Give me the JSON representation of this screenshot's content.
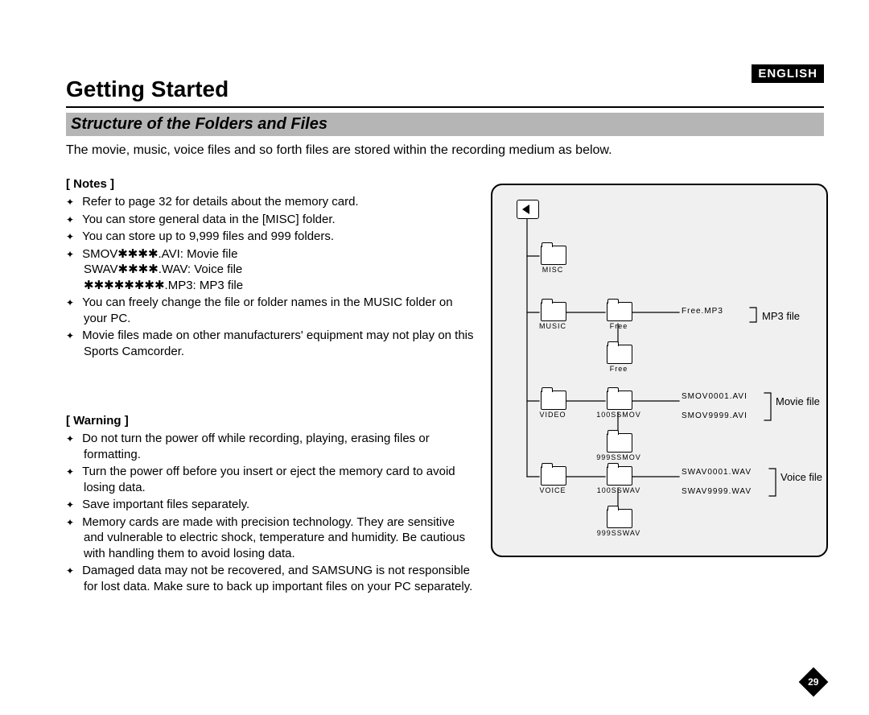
{
  "lang": "ENGLISH",
  "title": "Getting Started",
  "subtitle": "Structure of the Folders and Files",
  "intro": "The movie, music, voice files and so forth files are stored within the recording medium as below.",
  "notes": {
    "heading": "[ Notes ]",
    "items": [
      "Refer to page 32 for details about the memory card.",
      "You can store general data in the [MISC] folder.",
      "You can store up to 9,999 files and 999 folders.",
      "SMOV✱✱✱✱.AVI: Movie file\nSWAV✱✱✱✱.WAV: Voice file\n✱✱✱✱✱✱✱✱.MP3: MP3 file",
      "You can freely change the file or folder names in the MUSIC folder on your PC.",
      "Movie files made on other manufacturers' equipment may not play on this Sports Camcorder."
    ]
  },
  "warning": {
    "heading": "[ Warning ]",
    "items": [
      "Do not turn the power off while recording, playing, erasing files or formatting.",
      "Turn the power off before you insert or eject the memory card to avoid losing data.",
      "Save important files separately.",
      "Memory cards are made with precision technology. They are sensitive and vulnerable to electric shock, temperature and humidity. Be cautious with handling them to avoid losing data.",
      "Damaged data may not be recovered, and SAMSUNG is not responsible for lost data. Make sure to back up important files on your PC separately."
    ]
  },
  "diagram": {
    "folders": {
      "misc": "MISC",
      "music": "MUSIC",
      "free1": "Free",
      "free2": "Free",
      "video": "VIDEO",
      "vsub1": "100SSMOV",
      "vsub2": "999SSMOV",
      "voice": "VOICE",
      "wsub1": "100SSWAV",
      "wsub2": "999SSWAV"
    },
    "files": {
      "mp3": "Free.MP3",
      "movie1": "SMOV0001.AVI",
      "movie2": "SMOV9999.AVI",
      "voice1": "SWAV0001.WAV",
      "voice2": "SWAV9999.WAV"
    },
    "labels": {
      "mp3": "MP3 file",
      "movie": "Movie file",
      "voice": "Voice file"
    }
  },
  "page_number": "29"
}
